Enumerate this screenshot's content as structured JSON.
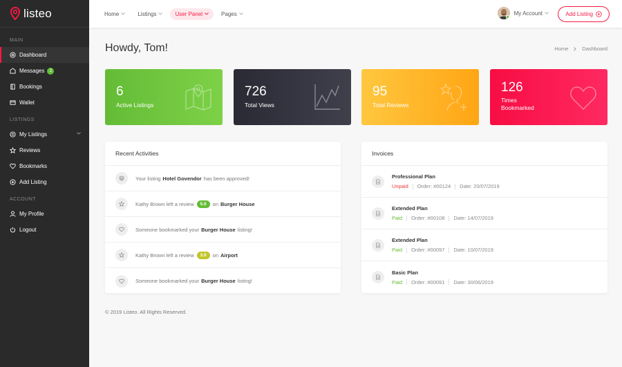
{
  "brand": {
    "name": "listeo",
    "accent": "#f91942",
    "green": "#64bc36"
  },
  "nav": [
    {
      "label": "Home",
      "active": false
    },
    {
      "label": "Listings",
      "active": false
    },
    {
      "label": "User Panel",
      "active": true
    },
    {
      "label": "Pages",
      "active": false
    }
  ],
  "account": {
    "label": "My Account"
  },
  "add_listing": {
    "label": "Add Listing"
  },
  "sidebar": {
    "sections": [
      {
        "title": "Main",
        "items": [
          {
            "label": "Dashboard",
            "icon": "dashboard-icon",
            "active": true
          },
          {
            "label": "Messages",
            "icon": "messages-icon",
            "badge": "2"
          },
          {
            "label": "Bookings",
            "icon": "bookings-icon"
          },
          {
            "label": "Wallet",
            "icon": "wallet-icon"
          }
        ]
      },
      {
        "title": "Listings",
        "items": [
          {
            "label": "My Listings",
            "icon": "list-icon",
            "has_submenu": true
          },
          {
            "label": "Reviews",
            "icon": "star-icon"
          },
          {
            "label": "Bookmarks",
            "icon": "heart-icon"
          },
          {
            "label": "Add Listing",
            "icon": "add-circle-icon"
          }
        ]
      },
      {
        "title": "Account",
        "items": [
          {
            "label": "My Profile",
            "icon": "user-icon"
          },
          {
            "label": "Logout",
            "icon": "power-icon"
          }
        ]
      }
    ]
  },
  "page": {
    "title": "Howdy, Tom!",
    "breadcrumb": [
      "Home",
      "Dashboard"
    ]
  },
  "stats": [
    {
      "value": "6",
      "label": "Active Listings",
      "icon": "map-icon"
    },
    {
      "value": "726",
      "label": "Total Views",
      "icon": "line-chart-icon"
    },
    {
      "value": "95",
      "label": "Total Reviews",
      "icon": "user-review-icon"
    },
    {
      "value": "126",
      "label": "Times Bookmarked",
      "icon": "heart-icon"
    }
  ],
  "activities": {
    "title": "Recent Activities",
    "items": [
      {
        "icon": "layers-icon",
        "pre": "Your listing",
        "bold": "Hotel Govendor",
        "post": "has been approved!"
      },
      {
        "icon": "star-icon",
        "pre": "Kathy Brown left a review",
        "rating": "5.0",
        "rating_color": "#64bc36",
        "mid": "on",
        "bold": "Burger House",
        "post": ""
      },
      {
        "icon": "heart-icon",
        "pre": "Someone bookmarked your",
        "bold": "Burger House",
        "post": "listing!"
      },
      {
        "icon": "star-icon",
        "pre": "Kathy Brown left a review",
        "rating": "3.0",
        "rating_color": "#c0c52a",
        "mid": "on",
        "bold": "Airport",
        "post": ""
      },
      {
        "icon": "heart-icon",
        "pre": "Someone bookmarked your",
        "bold": "Burger House",
        "post": "listing!"
      }
    ]
  },
  "invoices": {
    "title": "Invoices",
    "items": [
      {
        "plan": "Professional Plan",
        "status": "Unpaid",
        "order": "Order: #00124",
        "date": "Date: 20/07/2019"
      },
      {
        "plan": "Extended Plan",
        "status": "Paid",
        "order": "Order: #00108",
        "date": "Date: 14/07/2019"
      },
      {
        "plan": "Extended Plan",
        "status": "Paid",
        "order": "Order: #00097",
        "date": "Date: 10/07/2019"
      },
      {
        "plan": "Basic Plan",
        "status": "Paid",
        "order": "Order: #00091",
        "date": "Date: 30/06/2019"
      }
    ]
  },
  "footer": "© 2019 Listeo. All Rights Reserved."
}
